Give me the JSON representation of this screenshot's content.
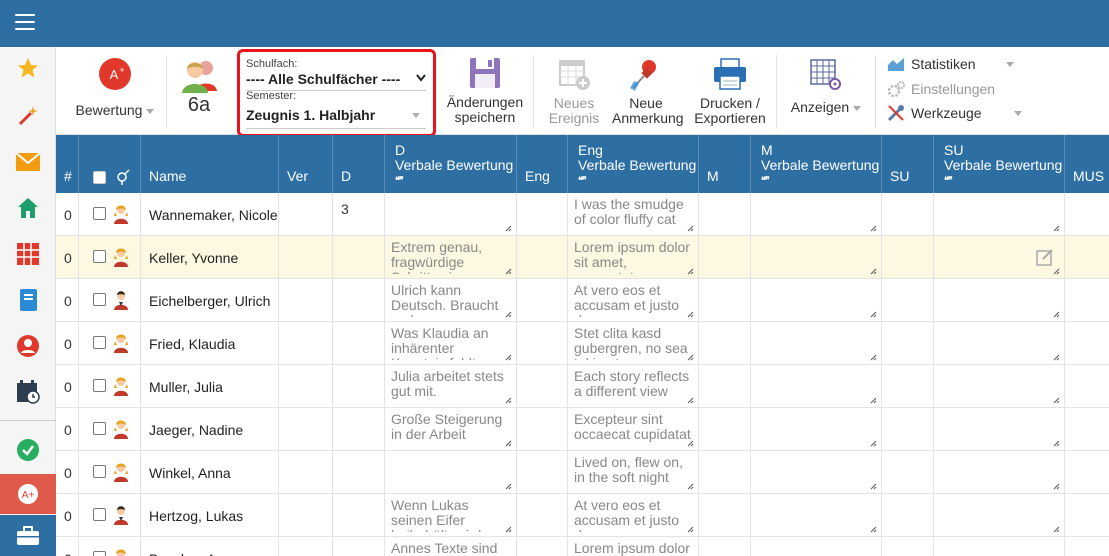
{
  "toolbar": {
    "grade_label": "Bewertung",
    "class_label": "6a",
    "subject_label": "Schulfach:",
    "subject_value": "---- Alle Schulfächer ----",
    "semester_label": "Semester:",
    "semester_value": "Zeugnis 1. Halbjahr",
    "save_line1": "Änderungen",
    "save_line2": "speichern",
    "new_event_line1": "Neues",
    "new_event_line2": "Ereignis",
    "new_note_line1": "Neue",
    "new_note_line2": "Anmerkung",
    "print_line1": "Drucken /",
    "print_line2": "Exportieren",
    "view_label": "Anzeigen",
    "stats_label": "Statistiken",
    "settings_label": "Einstellungen",
    "tools_label": "Werkzeuge"
  },
  "table": {
    "headers": {
      "num": "#",
      "name": "Name",
      "ver": "Ver",
      "d": "D",
      "d_verbal_1": "D",
      "d_verbal_2": "Verbale Bewertung",
      "eng": "Eng",
      "eng_verbal_1": "Eng",
      "eng_verbal_2": "Verbale Bewertung",
      "m": "M",
      "m_verbal_1": "M",
      "m_verbal_2": "Verbale Bewertung",
      "su": "SU",
      "su_verbal_1": "SU",
      "su_verbal_2": "Verbale Bewertung",
      "mus": "MUS",
      "quote": "❝❞"
    },
    "rows": [
      {
        "num": "0",
        "name": "Wannemaker, Nicole",
        "d": "3",
        "d_text": "",
        "eng_text": "I was the smudge of color fluffy cat",
        "gender": "f"
      },
      {
        "num": "0",
        "name": "Keller, Yvonne",
        "d": "",
        "d_text": "Extrem genau, fragwürdige Schrittweise",
        "eng_text": "Lorem ipsum dolor sit amet, consectetur",
        "gender": "f"
      },
      {
        "num": "0",
        "name": "Eichelberger, Ulrich",
        "d": "",
        "d_text": "Ulrich kann Deutsch. Braucht mehr",
        "eng_text": "At vero eos et accusam et justo duo",
        "gender": "m"
      },
      {
        "num": "0",
        "name": "Fried, Klaudia",
        "d": "",
        "d_text": "Was Klaudia an inhärenter Kenntnis fehlt",
        "eng_text": "Stet clita kasd gubergren, no sea takimata",
        "gender": "f"
      },
      {
        "num": "0",
        "name": "Muller, Julia",
        "d": "",
        "d_text": "Julia arbeitet stets gut mit.",
        "eng_text": "Each story reflects a different view",
        "gender": "f"
      },
      {
        "num": "0",
        "name": "Jaeger, Nadine",
        "d": "",
        "d_text": "Große Steigerung in der Arbeit",
        "eng_text": "Excepteur sint occaecat cupidatat non",
        "gender": "f"
      },
      {
        "num": "0",
        "name": "Winkel, Anna",
        "d": "",
        "d_text": "",
        "eng_text": "Lived on, flew on, in the soft night",
        "gender": "f"
      },
      {
        "num": "0",
        "name": "Hertzog, Lukas",
        "d": "",
        "d_text": "Wenn Lukas seinen Eifer beibehält, wird er",
        "eng_text": "At vero eos et accusam et justo duo",
        "gender": "m"
      },
      {
        "num": "0",
        "name": "Baecker, Anna",
        "d": "",
        "d_text": "Annes Texte sind gut",
        "eng_text": "Lorem ipsum dolor sit",
        "gender": "f"
      }
    ]
  }
}
